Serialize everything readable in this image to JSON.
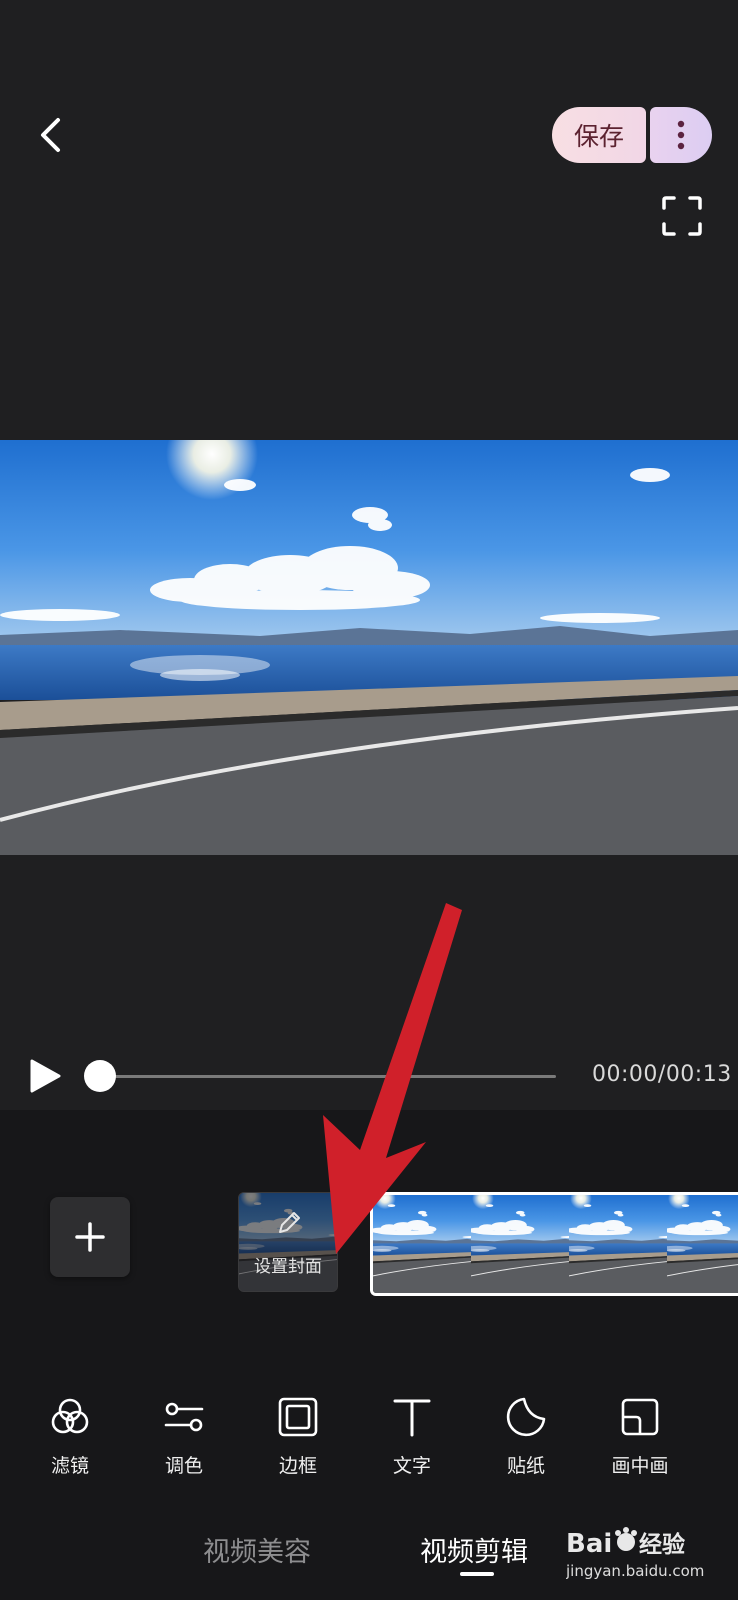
{
  "header": {
    "save_label": "保存",
    "back_icon": "chevron-left-icon",
    "more_icon": "more-vertical-icon",
    "fullscreen_icon": "fullscreen-icon"
  },
  "player": {
    "time": "00:00/00:13",
    "progress": 0
  },
  "timeline": {
    "cover_label": "设置封面",
    "frame_count": 4
  },
  "tools": [
    {
      "label": "滤镜",
      "icon": "filter-icon"
    },
    {
      "label": "调色",
      "icon": "adjust-icon"
    },
    {
      "label": "边框",
      "icon": "frame-icon"
    },
    {
      "label": "文字",
      "icon": "text-icon"
    },
    {
      "label": "贴纸",
      "icon": "sticker-icon"
    },
    {
      "label": "画中画",
      "icon": "picture-in-picture-icon"
    }
  ],
  "tabs": [
    {
      "label": "视频美容"
    },
    {
      "label": "视频剪辑"
    }
  ],
  "watermark": {
    "text": "Bai度经验",
    "url": "jingyan.baidu.com"
  },
  "colors": {
    "background": "#1f1f21",
    "panel": "#171719",
    "accent_arrow": "#d0202a",
    "save_bg": "#f8dfe3"
  }
}
